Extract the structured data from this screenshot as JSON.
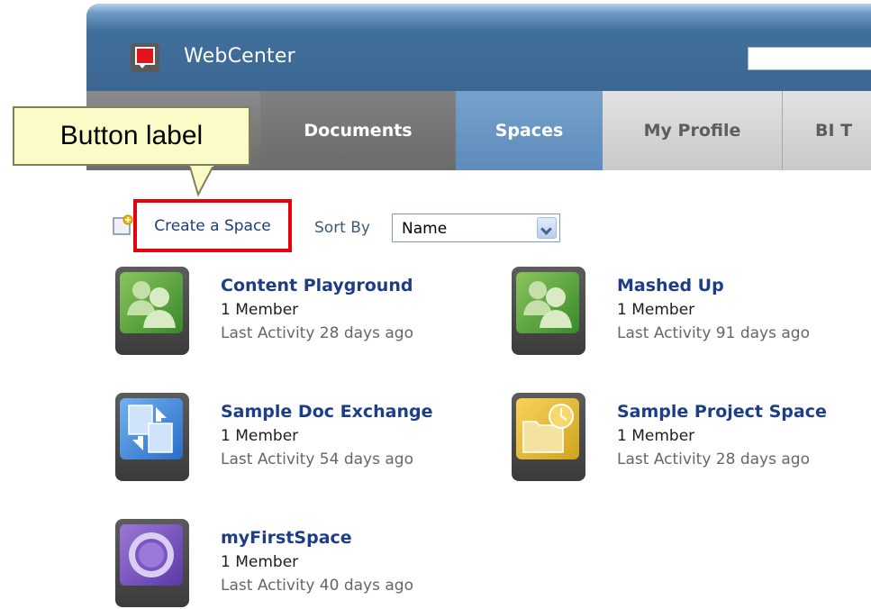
{
  "app": {
    "title": "WebCenter"
  },
  "header": {
    "search": {
      "value": ""
    }
  },
  "tabs": [
    {
      "label": ""
    },
    {
      "label": "Documents"
    },
    {
      "label": "Spaces"
    },
    {
      "label": "My Profile"
    },
    {
      "label": "BI T"
    }
  ],
  "callout": {
    "text": "Button label"
  },
  "toolbar": {
    "create_label": "Create a Space",
    "sort_label": "Sort By",
    "sort_value": "Name"
  },
  "spaces": [
    {
      "name": "Content Playground",
      "members": "1 Member",
      "activity": "Last Activity 28 days ago",
      "icon": "group-icon"
    },
    {
      "name": "Mashed Up",
      "members": "1 Member",
      "activity": "Last Activity 91 days ago",
      "icon": "group-icon"
    },
    {
      "name": "Sample Doc Exchange",
      "members": "1 Member",
      "activity": "Last Activity 54 days ago",
      "icon": "document-exchange-icon"
    },
    {
      "name": "Sample Project Space",
      "members": "1 Member",
      "activity": "Last Activity 28 days ago",
      "icon": "project-folder-icon"
    },
    {
      "name": "myFirstSpace",
      "members": "1 Member",
      "activity": "Last Activity 40 days ago",
      "icon": "ring-icon"
    }
  ],
  "colors": {
    "header_blue": "#3b6792",
    "active_tab": "#5d8bbb",
    "link": "#1d3d86",
    "highlight_box": "#e8000b",
    "callout_fill": "#fbfbc7"
  }
}
